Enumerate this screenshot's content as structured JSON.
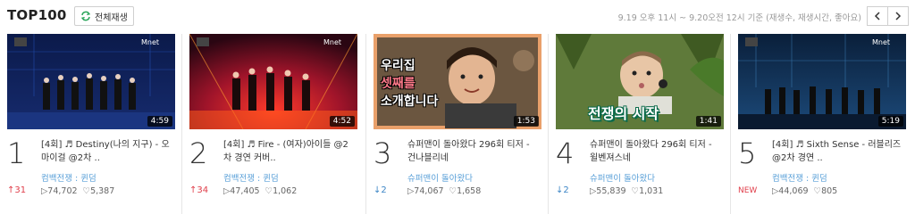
{
  "header": {
    "title": "TOP100",
    "play_all_label": "전체재생",
    "criteria": "9.19 오후 11시 ~ 9.20오전 12시 기준 (재생수, 재생시간, 좋아요)",
    "icons": {
      "play_all": "repeat-icon",
      "prev": "chevron-left-icon",
      "next": "chevron-right-icon"
    }
  },
  "cards": [
    {
      "rank": "1",
      "duration": "4:59",
      "title": "[4회] ♬ Destiny(나의 지구) - 오마이걸 @2차 ..",
      "channel": "컴백전쟁 : 퀸덤",
      "change": "↑31",
      "views": "▷74,702",
      "likes": "♡5,387"
    },
    {
      "rank": "2",
      "duration": "4:52",
      "title": "[4회] ♬ Fire - (여자)아이들 @2차 경연 커버..",
      "channel": "컴백전쟁 : 퀸덤",
      "change": "↑34",
      "views": "▷47,405",
      "likes": "♡1,062"
    },
    {
      "rank": "3",
      "duration": "1:53",
      "title": "슈퍼맨이 돌아왔다 296회 티저 - 건나블리네",
      "channel": "슈퍼맨이 돌아왔다",
      "change": "↓2",
      "views": "▷74,067",
      "likes": "♡1,658",
      "overlay_lines": [
        "우리집",
        "셋째를",
        "소개합니다"
      ]
    },
    {
      "rank": "4",
      "duration": "1:41",
      "title": "슈퍼맨이 돌아왔다 296회 티저 - 윌벤져스네",
      "channel": "슈퍼맨이 돌아왔다",
      "change": "↓2",
      "views": "▷55,839",
      "likes": "♡1,031",
      "overlay_lines": [
        "전쟁의 시작"
      ]
    },
    {
      "rank": "5",
      "duration": "5:19",
      "title": "[4회] ♬ Sixth Sense - 러블리즈 @2차 경연 ..",
      "channel": "컴백전쟁 : 퀸덤",
      "change": "NEW",
      "views": "▷44,069",
      "likes": "♡805"
    }
  ],
  "colors": {
    "rank_up": "#e03e4a",
    "rank_down": "#3d86c6",
    "channel": "#5aa0d8"
  }
}
